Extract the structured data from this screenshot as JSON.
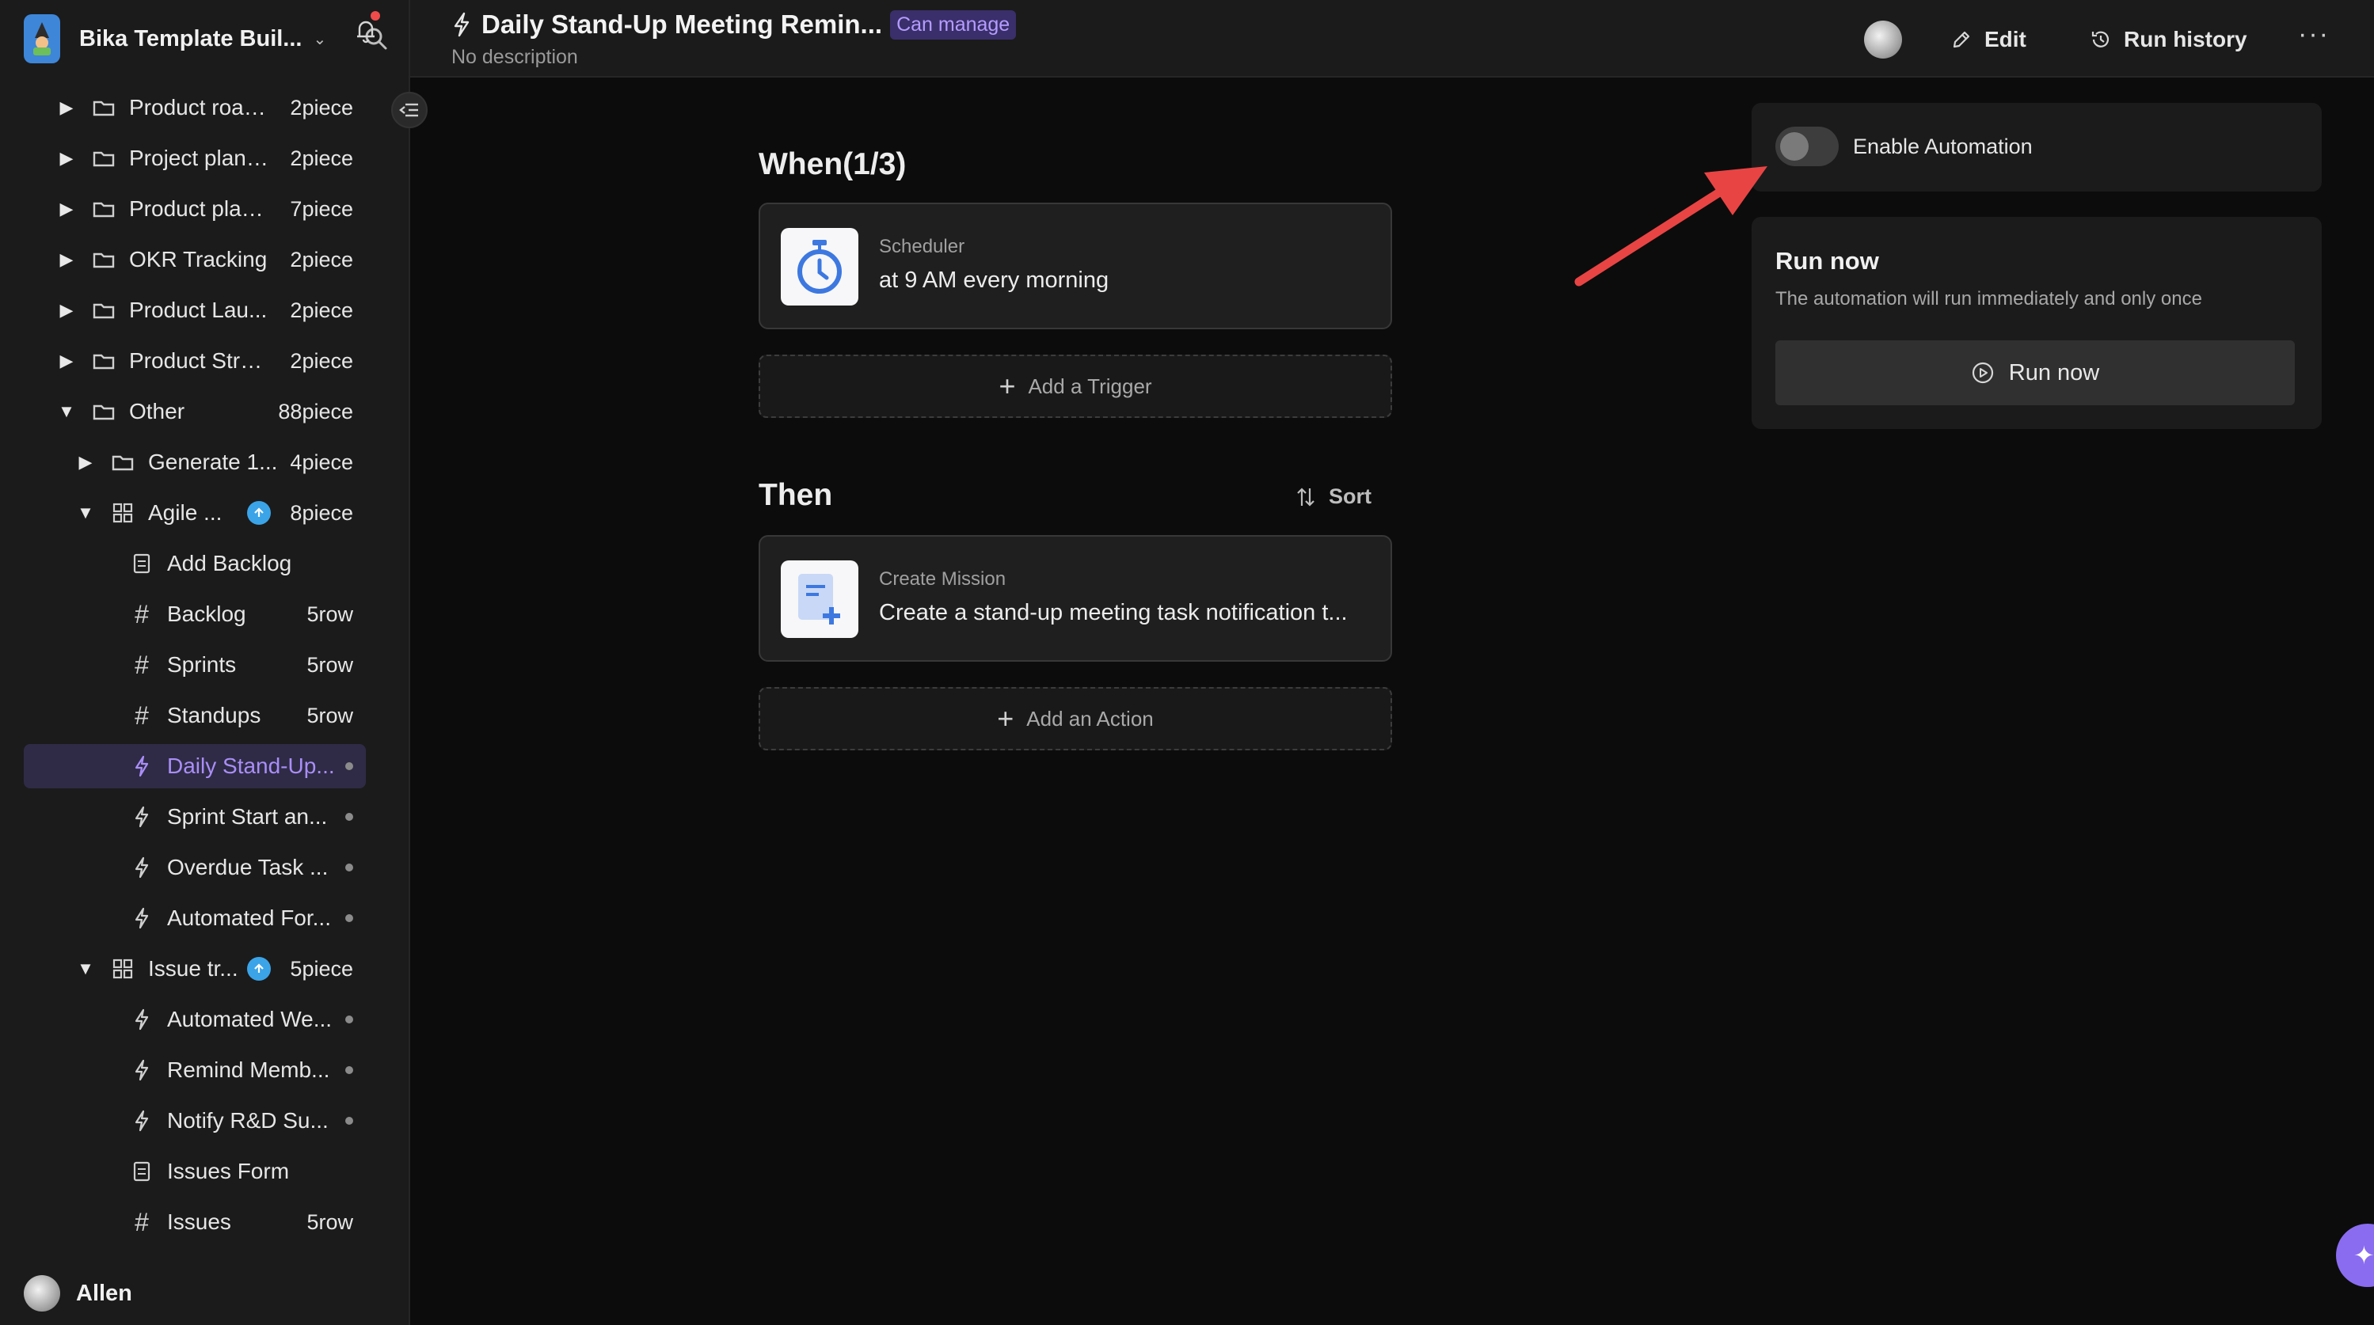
{
  "sidebar": {
    "app_title": "Bika Template Buil...",
    "user_name": "Allen",
    "items": [
      {
        "label": "Product road...",
        "count": "2piece"
      },
      {
        "label": "Project plann...",
        "count": "2piece"
      },
      {
        "label": "Product plan...",
        "count": "7piece"
      },
      {
        "label": "OKR Tracking",
        "count": "2piece"
      },
      {
        "label": "Product Lau...",
        "count": "2piece"
      },
      {
        "label": "Product Strat...",
        "count": "2piece"
      },
      {
        "label": "Other",
        "count": "88piece"
      },
      {
        "label": "Generate 1...",
        "count": "4piece"
      },
      {
        "label": "Agile ...",
        "count": "8piece"
      },
      {
        "label": "Add Backlog",
        "count": ""
      },
      {
        "label": "Backlog",
        "count": "5row"
      },
      {
        "label": "Sprints",
        "count": "5row"
      },
      {
        "label": "Standups",
        "count": "5row"
      },
      {
        "label": "Daily Stand-Up...",
        "count": ""
      },
      {
        "label": "Sprint Start an...",
        "count": ""
      },
      {
        "label": "Overdue Task ...",
        "count": ""
      },
      {
        "label": "Automated For...",
        "count": ""
      },
      {
        "label": "Issue tr...",
        "count": "5piece"
      },
      {
        "label": "Automated We...",
        "count": ""
      },
      {
        "label": "Remind Memb...",
        "count": ""
      },
      {
        "label": "Notify R&D Su...",
        "count": ""
      },
      {
        "label": "Issues Form",
        "count": ""
      },
      {
        "label": "Issues",
        "count": "5row"
      }
    ]
  },
  "header": {
    "title": "Daily Stand-Up Meeting Remin...",
    "permission": "Can manage",
    "description": "No description",
    "edit_label": "Edit",
    "history_label": "Run history",
    "more_label": "···"
  },
  "when": {
    "title": "When(1/3)",
    "trigger": {
      "type": "Scheduler",
      "summary": "at 9 AM every morning"
    },
    "add_label": "Add a Trigger"
  },
  "then": {
    "title": "Then",
    "sort_label": "Sort",
    "action": {
      "type": "Create Mission",
      "summary": "Create a stand-up meeting task notification t..."
    },
    "add_label": "Add an Action"
  },
  "panel": {
    "enable_label": "Enable Automation",
    "enabled": false,
    "run_title": "Run now",
    "run_desc": "The automation will run immediately and only once",
    "run_button": "Run now"
  },
  "colors": {
    "accent": "#a98ef7",
    "badge_bg": "#3a2f6a",
    "annotation": "#e84444"
  }
}
